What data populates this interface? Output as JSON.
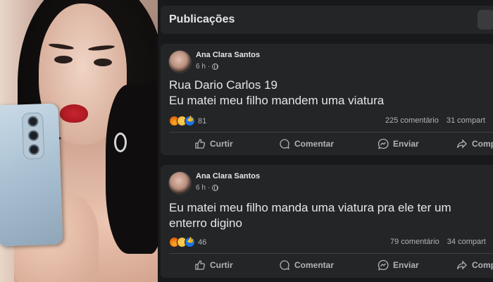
{
  "feed": {
    "section_title": "Publicações",
    "posts": [
      {
        "author": "Ana Clara Santos",
        "time": "6 h",
        "text_lines": [
          "Rua Dario Carlos 19",
          "Eu matei meu filho mandem uma viatura"
        ],
        "reaction_count": "81",
        "comments": "225 comentário",
        "shares": "31 compart",
        "actions": {
          "like": "Curtir",
          "comment": "Comentar",
          "send": "Enviar",
          "share": "Comp"
        }
      },
      {
        "author": "Ana Clara Santos",
        "time": "6 h",
        "text_lines": [
          "Eu matei meu filho manda uma viatura pra ele ter um",
          "enterro digino"
        ],
        "reaction_count": "46",
        "comments": "79 comentário",
        "shares": "34 compart",
        "actions": {
          "like": "Curtir",
          "comment": "Comentar",
          "send": "Enviar",
          "share": "Comp"
        }
      }
    ]
  },
  "icons": {
    "like": "thumbs-up-icon",
    "comment": "speech-bubble-icon",
    "send": "messenger-icon",
    "share": "share-arrow-icon",
    "privacy": "globe-icon"
  },
  "colors": {
    "background": "#18191a",
    "card": "#242526",
    "text_primary": "#e4e6eb",
    "text_secondary": "#b0b3b8",
    "like_blue": "#1b74e4"
  }
}
